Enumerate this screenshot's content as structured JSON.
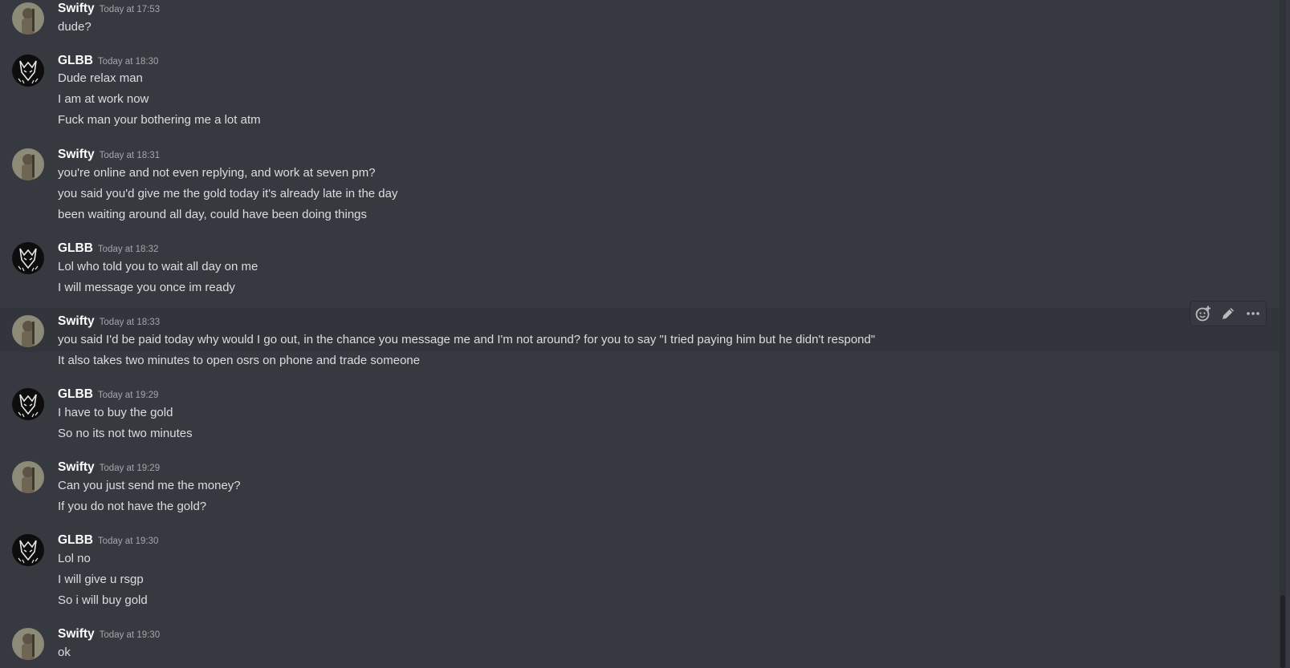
{
  "messages": [
    {
      "author": "Swifty",
      "time": "Today at 17:53",
      "lines": [
        "dude?"
      ]
    },
    {
      "author": "GLBB",
      "time": "Today at 18:30",
      "lines": [
        "Dude relax man",
        "I am at work now",
        "Fuck man your bothering me a lot atm"
      ]
    },
    {
      "author": "Swifty",
      "time": "Today at 18:31",
      "lines": [
        "you're online and not even replying, and work at seven pm?",
        "you said you'd give me the gold today it's already late in the day",
        "been waiting around all day, could have been doing things"
      ]
    },
    {
      "author": "GLBB",
      "time": "Today at 18:32",
      "lines": [
        "Lol who told you to wait all day on me",
        "I will message you once im ready"
      ]
    },
    {
      "author": "Swifty",
      "time": "Today at 18:33",
      "lines": [
        "you said I'd be paid today why would I go out, in the chance you message me and I'm not around? for you to say \"I tried paying him but he didn't respond\"",
        "It also takes two minutes to open osrs on phone and trade someone"
      ]
    },
    {
      "author": "GLBB",
      "time": "Today at 19:29",
      "lines": [
        "I have to buy the gold",
        "So no its not two minutes"
      ]
    },
    {
      "author": "Swifty",
      "time": "Today at 19:29",
      "lines": [
        "Can you just send me the money?",
        "If you do not have the gold?"
      ]
    },
    {
      "author": "GLBB",
      "time": "Today at 19:30",
      "lines": [
        "Lol no",
        "I will give u rsgp",
        "So i will buy gold"
      ]
    },
    {
      "author": "Swifty",
      "time": "Today at 19:30",
      "lines": [
        "ok"
      ]
    }
  ],
  "toolbar": {
    "icons": [
      "add-reaction-icon",
      "edit-icon",
      "more-options-icon"
    ]
  },
  "colors": {
    "background": "#36393f",
    "hover_background": "#32353b",
    "username": "#ffffff",
    "timestamp": "#a3a6aa",
    "message_text": "#dcddde"
  }
}
